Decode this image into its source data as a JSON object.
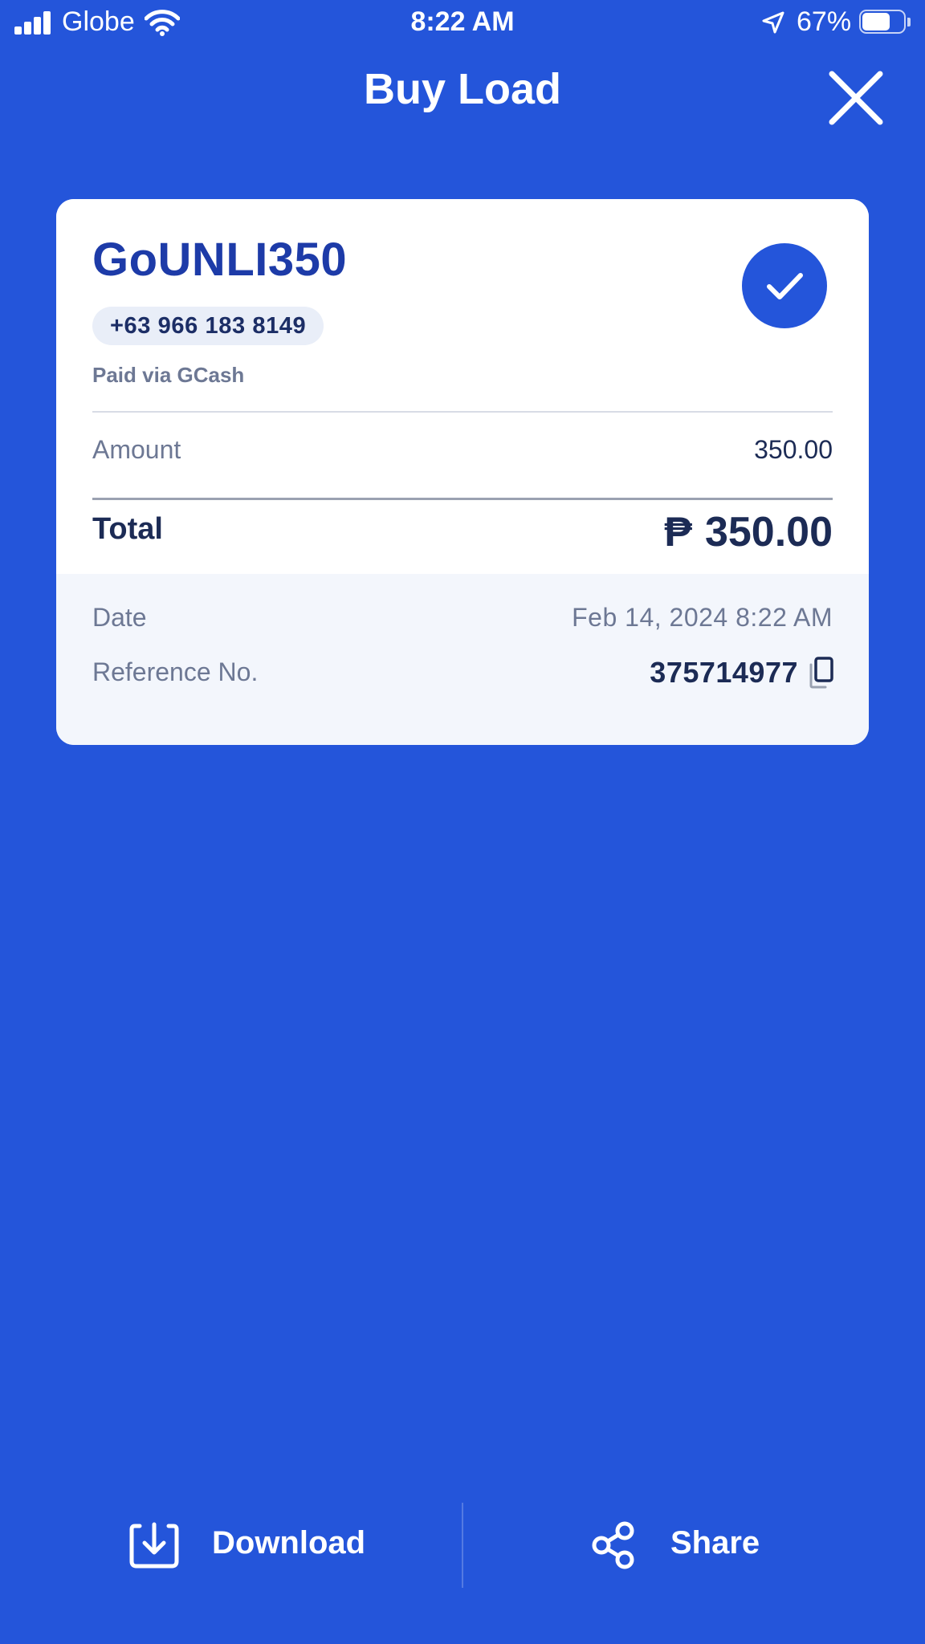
{
  "status_bar": {
    "carrier": "Globe",
    "time": "8:22 AM",
    "battery_percent": "67%",
    "battery_level": 0.67,
    "signal_bars": 4,
    "icons": [
      "signal-icon",
      "wifi-icon",
      "location-arrow-icon",
      "battery-icon"
    ]
  },
  "header": {
    "title": "Buy Load",
    "close_icon": "close-icon"
  },
  "receipt": {
    "product_name": "GoUNLI350",
    "mobile_number": "+63 966 183 8149",
    "payment_method": "Paid via GCash",
    "status_icon": "check-icon",
    "amount_label": "Amount",
    "amount_value": "350.00",
    "total_label": "Total",
    "total_currency": "₱",
    "total_value": "350.00",
    "date_label": "Date",
    "date_value": "Feb 14, 2024 8:22 AM",
    "reference_label": "Reference No.",
    "reference_value": "375714977",
    "copy_icon": "copy-icon"
  },
  "actions": {
    "download_label": "Download",
    "download_icon": "download-icon",
    "share_label": "Share",
    "share_icon": "share-icon"
  },
  "colors": {
    "background": "#2455DA",
    "card": "#FFFFFF",
    "card_footer": "#F3F6FC",
    "primary_text": "#1C2B55",
    "product_name": "#1D3BA8",
    "muted_text": "#6D7894"
  }
}
